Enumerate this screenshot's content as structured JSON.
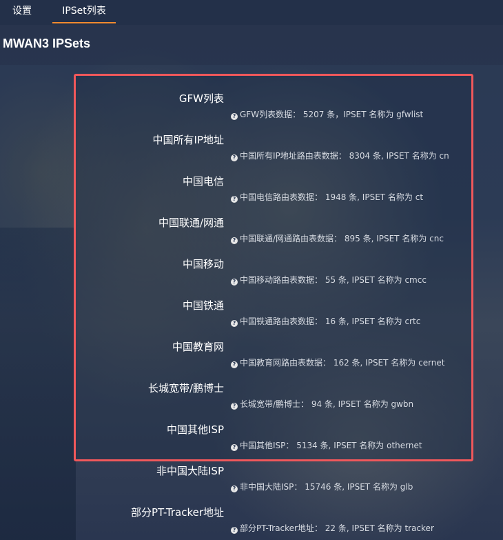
{
  "tabs": [
    {
      "label": "设置"
    },
    {
      "label": "IPSet列表",
      "active": true
    }
  ],
  "page_title": "MWAN3 IPSets",
  "accent_color": "#f28a2e",
  "highlight_color": "#f1585b",
  "help_icon": "help-circle-icon",
  "rows": [
    {
      "label": "GFW列表",
      "desc": "GFW列表数据： 5207 条，IPSET 名称为 gfwlist"
    },
    {
      "label": "中国所有IP地址",
      "desc": "中国所有IP地址路由表数据： 8304 条, IPSET 名称为 cn"
    },
    {
      "label": "中国电信",
      "desc": "中国电信路由表数据： 1948 条, IPSET 名称为 ct"
    },
    {
      "label": "中国联通/网通",
      "desc": "中国联通/网通路由表数据： 895 条, IPSET 名称为 cnc"
    },
    {
      "label": "中国移动",
      "desc": "中国移动路由表数据： 55 条, IPSET 名称为 cmcc"
    },
    {
      "label": "中国铁通",
      "desc": "中国铁通路由表数据： 16 条, IPSET 名称为 crtc"
    },
    {
      "label": "中国教育网",
      "desc": "中国教育网路由表数据： 162 条, IPSET 名称为 cernet"
    },
    {
      "label": "长城宽带/鹏博士",
      "desc": "长城宽带/鹏博士： 94 条, IPSET 名称为 gwbn"
    },
    {
      "label": "中国其他ISP",
      "desc": "中国其他ISP： 5134 条, IPSET 名称为 othernet"
    },
    {
      "label": "非中国大陆ISP",
      "desc": "非中国大陆ISP： 15746 条, IPSET 名称为 glb"
    },
    {
      "label": "部分PT-Tracker地址",
      "desc": "部分PT-Tracker地址： 22 条, IPSET 名称为 tracker"
    }
  ]
}
